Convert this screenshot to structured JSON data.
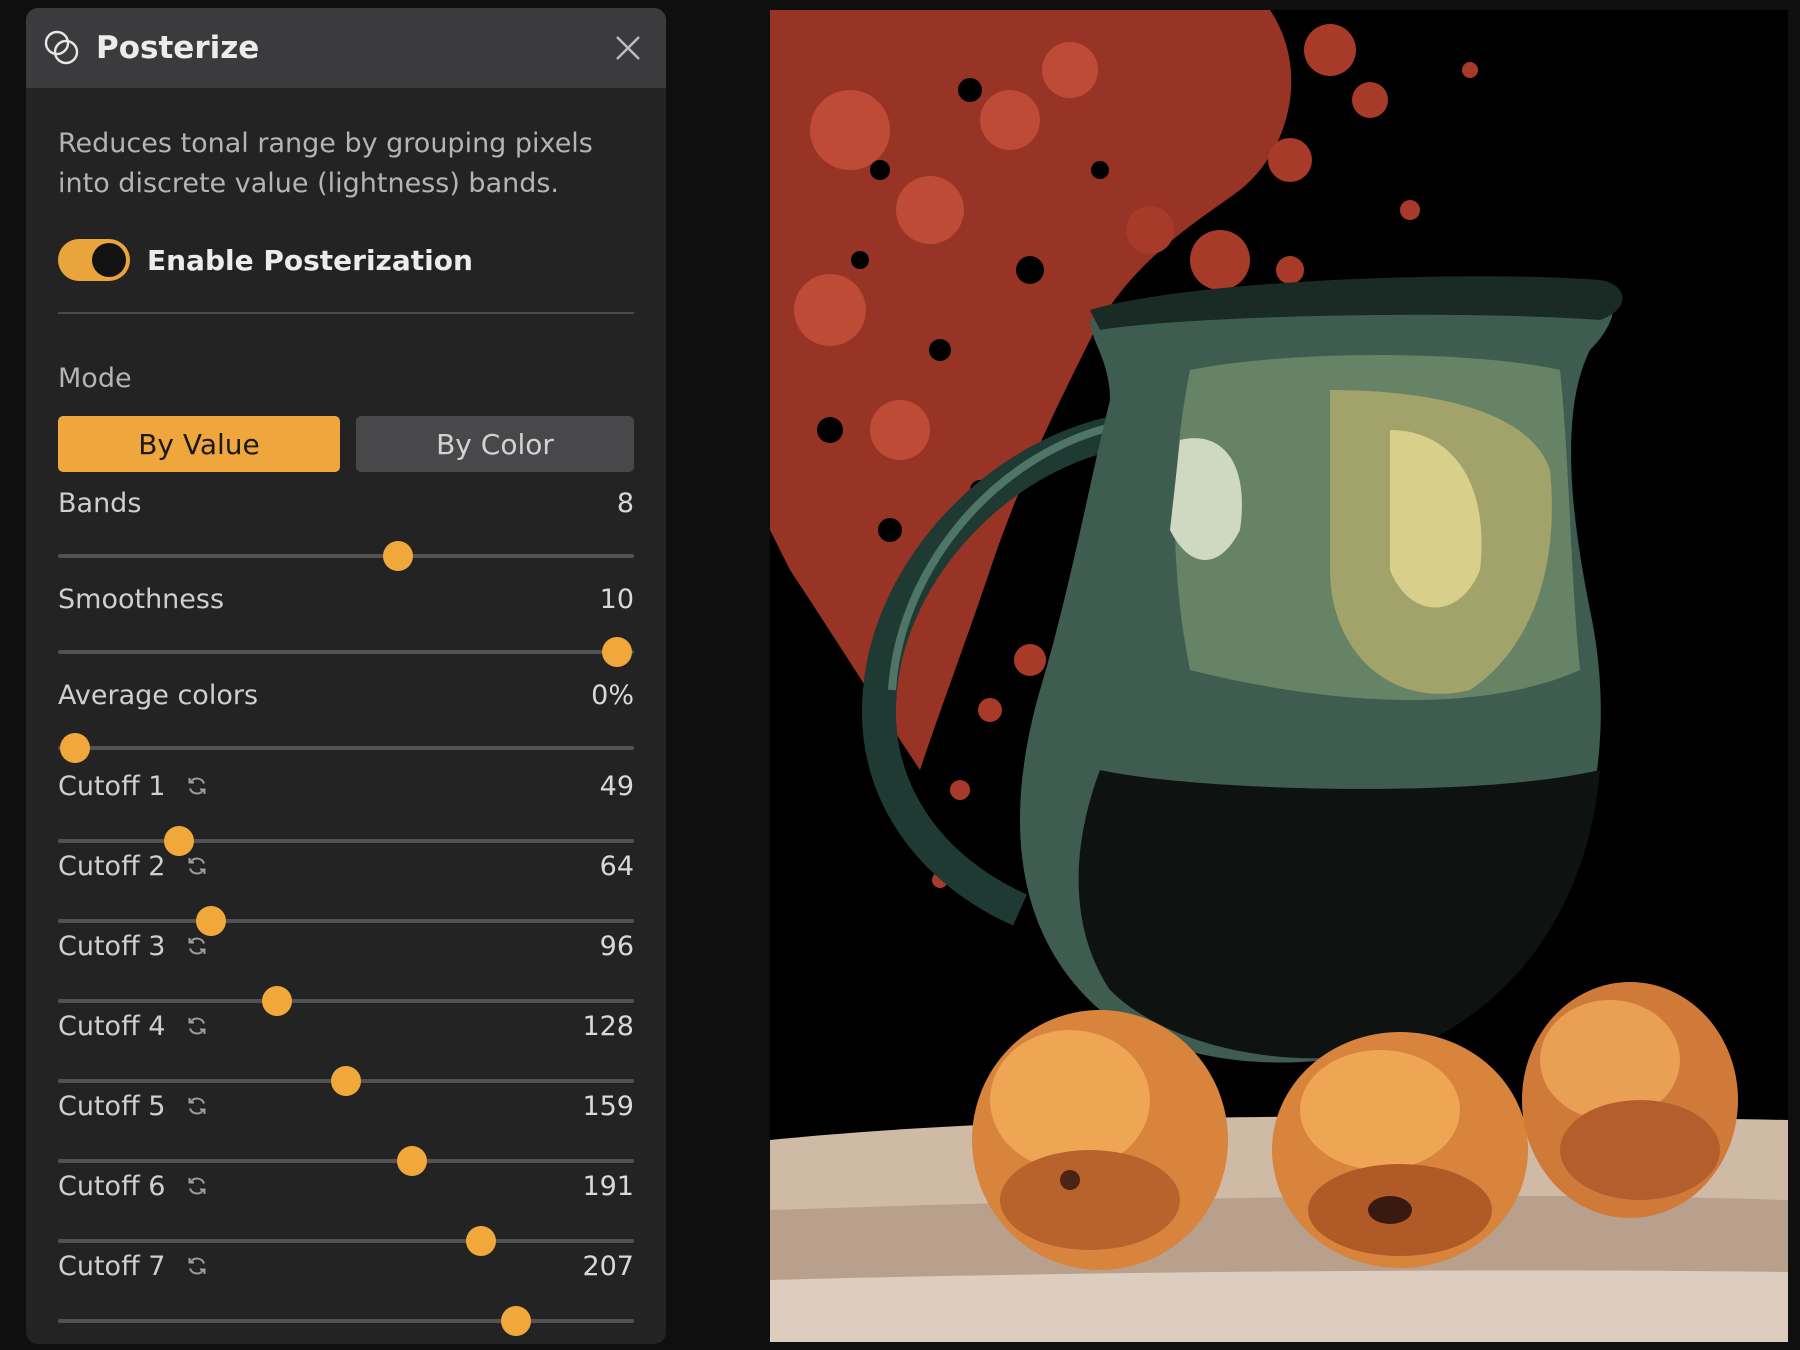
{
  "panel": {
    "title": "Posterize",
    "title_icon": "overlapping-circles-icon",
    "close_icon": "close-icon",
    "description": "Reduces tonal range by grouping pixels into discrete value (lightness) bands.",
    "toggle": {
      "label": "Enable Posterization",
      "on": true
    },
    "mode": {
      "label": "Mode",
      "options": [
        "By Value",
        "By Color"
      ],
      "selected": "By Value"
    },
    "sliders": [
      {
        "label": "Bands",
        "value": "8",
        "fraction": 0.59,
        "resettable": false
      },
      {
        "label": "Smoothness",
        "value": "10",
        "fraction": 0.97,
        "resettable": false
      },
      {
        "label": "Average colors",
        "value": "0%",
        "fraction": 0.03,
        "resettable": false
      },
      {
        "label": "Cutoff 1",
        "value": "49",
        "fraction": 0.21,
        "resettable": true
      },
      {
        "label": "Cutoff 2",
        "value": "64",
        "fraction": 0.265,
        "resettable": true
      },
      {
        "label": "Cutoff 3",
        "value": "96",
        "fraction": 0.38,
        "resettable": true
      },
      {
        "label": "Cutoff 4",
        "value": "128",
        "fraction": 0.5,
        "resettable": true
      },
      {
        "label": "Cutoff 5",
        "value": "159",
        "fraction": 0.615,
        "resettable": true
      },
      {
        "label": "Cutoff 6",
        "value": "191",
        "fraction": 0.735,
        "resettable": true
      },
      {
        "label": "Cutoff 7",
        "value": "207",
        "fraction": 0.795,
        "resettable": true
      }
    ]
  },
  "colors": {
    "accent": "#efa63c",
    "panel_bg": "#232324",
    "header_bg": "#3b3b3d",
    "track": "#525254"
  }
}
